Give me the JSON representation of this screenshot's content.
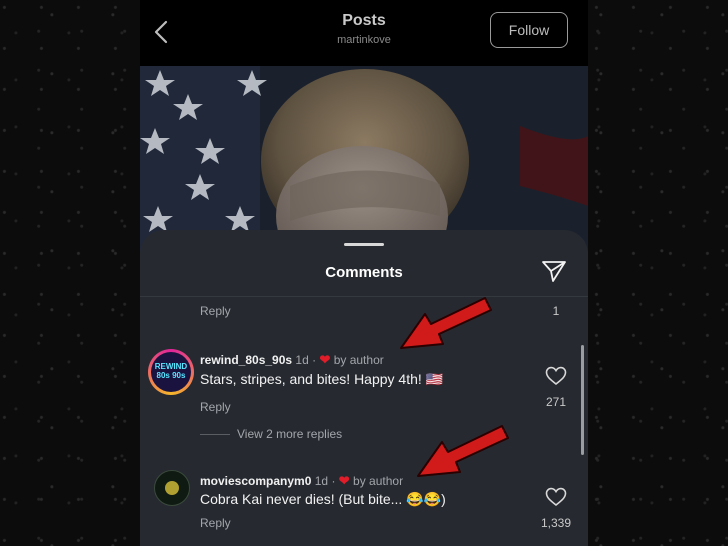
{
  "header": {
    "back_icon": "chevron-left-icon",
    "title": "Posts",
    "subtitle": "martinkove",
    "follow_label": "Follow"
  },
  "sheet": {
    "title": "Comments",
    "share_icon": "send-icon"
  },
  "top_row": {
    "reply_label": "Reply",
    "like_count": "1"
  },
  "comments": [
    {
      "username": "rewind_80s_90s",
      "avatar_text": "REWIND 80s 90s",
      "time": "1d",
      "liked_by": "by author",
      "text": "Stars, stripes, and bites! Happy 4th! 🇺🇸",
      "reply_label": "Reply",
      "like_count": "271",
      "view_replies": "View 2 more replies"
    },
    {
      "username": "moviescompanym0",
      "time": "1d",
      "liked_by": "by author",
      "text": "Cobra Kai never dies! (But bite... 😂😂)",
      "reply_label": "Reply",
      "like_count": "1,339"
    }
  ],
  "colors": {
    "sheet_bg": "#262a30",
    "heart": "#e11d2a",
    "annotation_arrow": "#d11a1a"
  }
}
